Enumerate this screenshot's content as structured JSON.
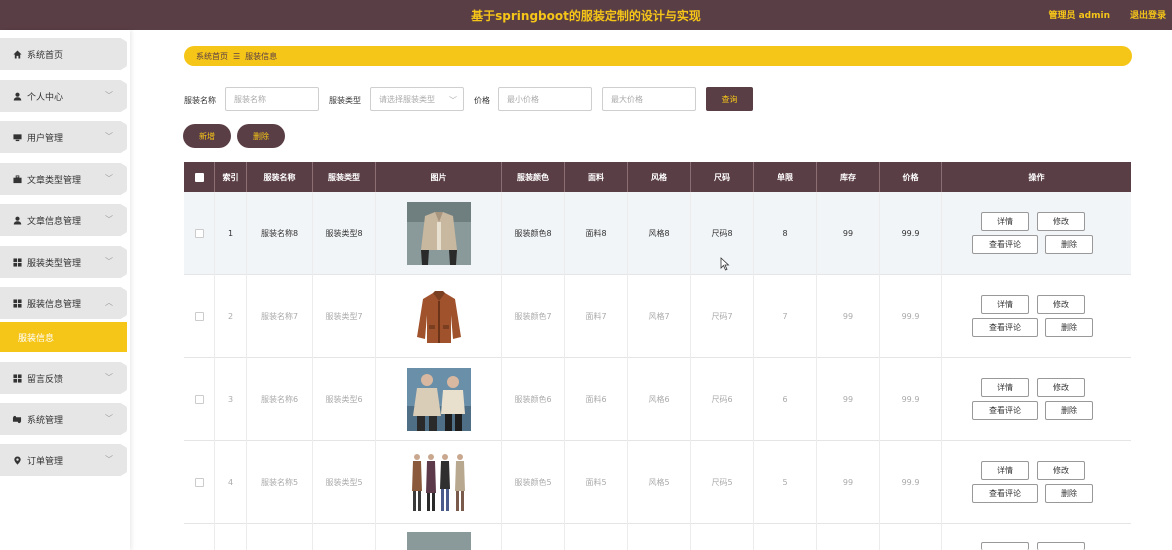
{
  "header": {
    "title": "基于springboot的服装定制的设计与实现",
    "admin": "管理员 admin",
    "logout": "退出登录"
  },
  "sidebar": {
    "items": [
      {
        "label": "系统首页",
        "icon": "home-icon"
      },
      {
        "label": "个人中心",
        "icon": "user-icon"
      },
      {
        "label": "用户管理",
        "icon": "users-icon"
      },
      {
        "label": "文章类型管理",
        "icon": "briefcase-icon"
      },
      {
        "label": "文章信息管理",
        "icon": "user-icon"
      },
      {
        "label": "服装类型管理",
        "icon": "grid-icon"
      },
      {
        "label": "服装信息管理",
        "icon": "grid-icon"
      },
      {
        "label": "留言反馈",
        "icon": "grid-icon"
      },
      {
        "label": "系统管理",
        "icon": "settings-icon"
      },
      {
        "label": "订单管理",
        "icon": "pin-icon"
      }
    ],
    "active_sub": "服装信息"
  },
  "breadcrumb": {
    "home": "系统首页",
    "current": "服装信息"
  },
  "search": {
    "name_label": "服装名称",
    "name_placeholder": "服装名称",
    "type_label": "服装类型",
    "type_placeholder": "请选择服装类型",
    "price_label": "价格",
    "min_placeholder": "最小价格",
    "max_placeholder": "最大价格",
    "query_button": "查询"
  },
  "actions": {
    "add": "新增",
    "delete": "删除"
  },
  "table": {
    "columns": [
      "索引",
      "服装名称",
      "服装类型",
      "图片",
      "服装颜色",
      "面料",
      "风格",
      "尺码",
      "单限",
      "库存",
      "价格",
      "操作"
    ],
    "rows": [
      {
        "index": "1",
        "name": "服装名称8",
        "type": "服装类型8",
        "color": "服装颜色8",
        "fabric": "面料8",
        "style": "风格8",
        "size": "尺码8",
        "limit": "8",
        "stock": "99",
        "price": "99.9"
      },
      {
        "index": "2",
        "name": "服装名称7",
        "type": "服装类型7",
        "color": "服装颜色7",
        "fabric": "面料7",
        "style": "风格7",
        "size": "尺码7",
        "limit": "7",
        "stock": "99",
        "price": "99.9"
      },
      {
        "index": "3",
        "name": "服装名称6",
        "type": "服装类型6",
        "color": "服装颜色6",
        "fabric": "面料6",
        "style": "风格6",
        "size": "尺码6",
        "limit": "6",
        "stock": "99",
        "price": "99.9"
      },
      {
        "index": "4",
        "name": "服装名称5",
        "type": "服装类型5",
        "color": "服装颜色5",
        "fabric": "面料5",
        "style": "风格5",
        "size": "尺码5",
        "limit": "5",
        "stock": "99",
        "price": "99.9"
      }
    ],
    "ops": {
      "detail": "详情",
      "edit": "修改",
      "comments": "查看评论",
      "delete": "删除"
    }
  },
  "colors": {
    "brand_dark": "#5a3e45",
    "accent_yellow": "#f5c518"
  }
}
